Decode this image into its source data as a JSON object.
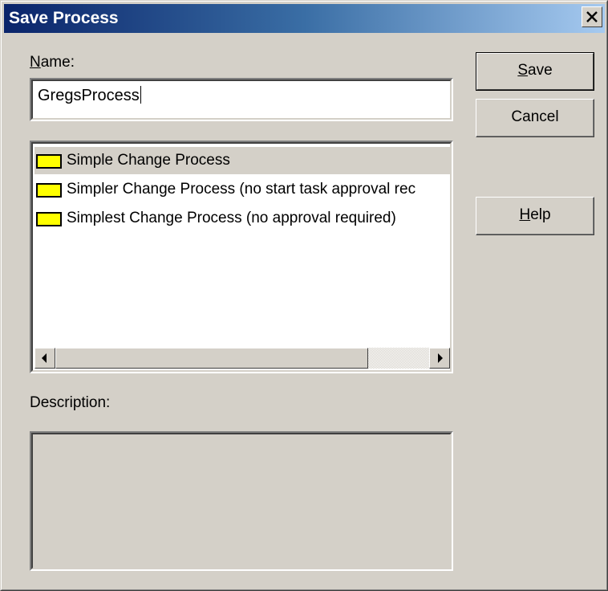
{
  "window": {
    "title": "Save Process"
  },
  "name": {
    "label_mnemonic": "N",
    "label_rest": "ame:",
    "value": "GregsProcess"
  },
  "process_list": {
    "items": [
      {
        "label": "Simple Change Process",
        "selected": true
      },
      {
        "label": "Simpler Change Process (no start task approval rec",
        "selected": false
      },
      {
        "label": "Simplest Change Process (no approval required)",
        "selected": false
      }
    ]
  },
  "description": {
    "label": "Description:",
    "value": ""
  },
  "buttons": {
    "save": {
      "mnemonic": "S",
      "rest": "ave"
    },
    "cancel": {
      "label": "Cancel"
    },
    "help": {
      "mnemonic": "H",
      "rest": "elp"
    }
  },
  "icons": {
    "close": "close-icon",
    "folder": "folder-icon",
    "scroll_left": "arrow-left-icon",
    "scroll_right": "arrow-right-icon"
  },
  "colors": {
    "title_start": "#0a246a",
    "title_end": "#a6caf0",
    "face": "#d4d0c8",
    "folder": "#ffff00"
  }
}
